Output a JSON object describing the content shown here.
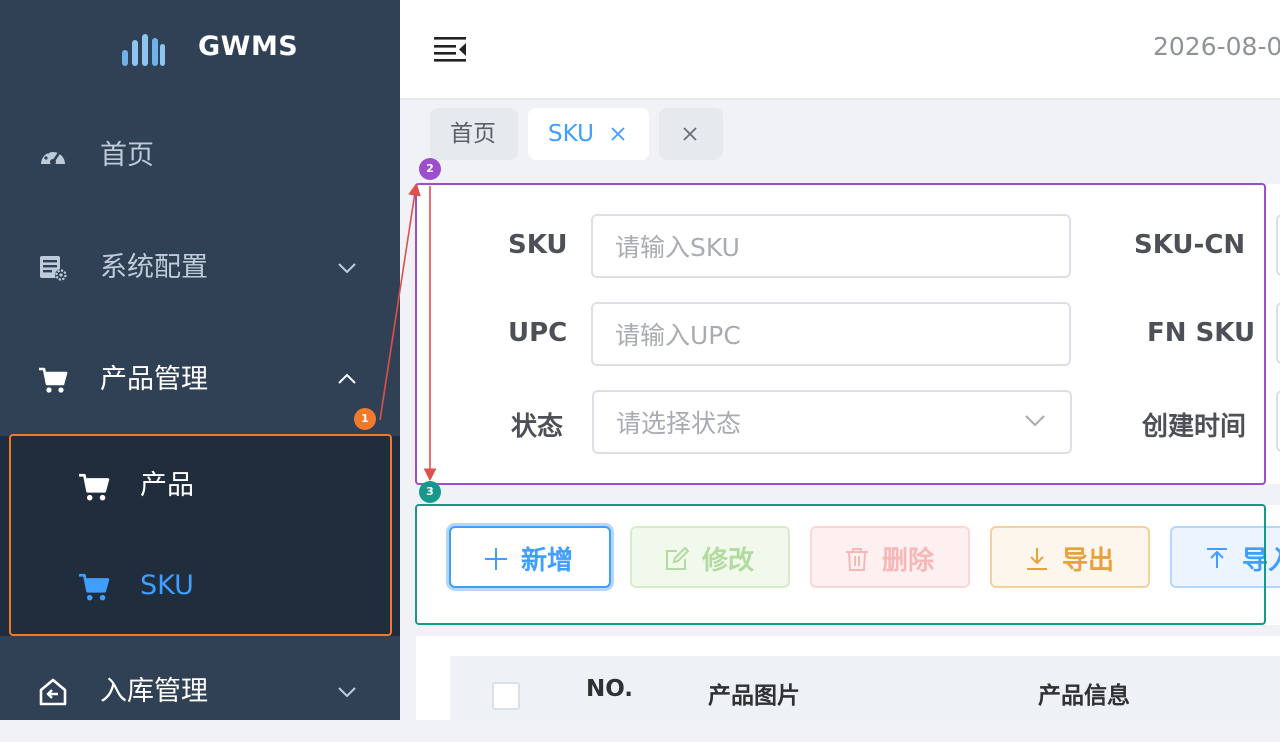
{
  "app": {
    "logo_text": "GWMS"
  },
  "sidebar": {
    "items": [
      {
        "label": "首页",
        "icon": "dashboard-icon"
      },
      {
        "label": "系统配置",
        "icon": "settings-icon"
      },
      {
        "label": "产品管理",
        "icon": "cart-icon"
      },
      {
        "label": "入库管理",
        "icon": "inbound-icon"
      }
    ],
    "subitems": [
      {
        "label": "产品",
        "icon": "cart-icon"
      },
      {
        "label": "SKU",
        "icon": "cart-icon"
      }
    ]
  },
  "header": {
    "datetime": "2026-08-0"
  },
  "tags": [
    {
      "label": "首页"
    },
    {
      "label": "SKU"
    }
  ],
  "filters": {
    "sku_label": "SKU",
    "sku_placeholder": "请输入SKU",
    "upc_label": "UPC",
    "upc_placeholder": "请输入UPC",
    "status_label": "状态",
    "status_placeholder": "请选择状态",
    "skucn_label": "SKU-CN",
    "fnsku_label": "FN SKU",
    "created_label": "创建时间"
  },
  "toolbar": {
    "add_label": "新增",
    "edit_label": "修改",
    "delete_label": "删除",
    "export_label": "导出",
    "import_label": "导入"
  },
  "table": {
    "columns": [
      "NO.",
      "产品图片",
      "产品信息"
    ]
  },
  "annotations": [
    "1",
    "2",
    "3"
  ],
  "colors": {
    "sidebar_bg": "#304156",
    "submenu_bg": "#1f2d3d",
    "primary": "#409eff",
    "success": "#67c23a",
    "danger": "#f56c6c",
    "warning": "#e6a23c",
    "annot_orange": "#f07a2a",
    "annot_purple": "#9b4fcc",
    "annot_teal": "#17998a"
  }
}
